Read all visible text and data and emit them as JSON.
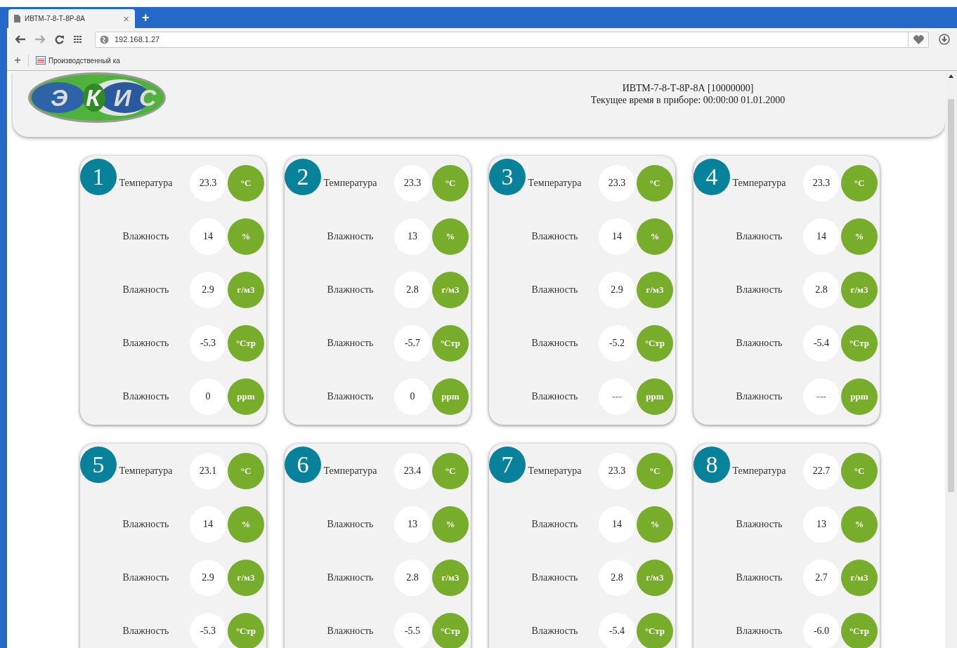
{
  "browser": {
    "tab_title": "ИВТМ-7-8-Т-8Р-8А",
    "tab_close": "×",
    "new_tab": "+",
    "address": "192.168.1.27",
    "bookmark_add": "+",
    "bookmark": "Производственный ка"
  },
  "header": {
    "logo_letters": [
      "Э",
      "К",
      "И",
      "С"
    ],
    "device": "ИВТМ-7-8-Т-8Р-8А [10000000]",
    "time": "Текущее время в приборе: 00:00:00 01.01.2000"
  },
  "channels": [
    {
      "number": "1",
      "rows": [
        {
          "label": "Температура",
          "value": "23.3",
          "kind": "ok",
          "unit": "°C"
        },
        {
          "label": "Влажность",
          "value": "14",
          "kind": "ok",
          "unit": "%"
        },
        {
          "label": "Влажность",
          "value": "2.9",
          "kind": "ok",
          "unit": "г/м3"
        },
        {
          "label": "Влажность",
          "value": "-5.3",
          "kind": "ok",
          "unit": "°Стр"
        },
        {
          "label": "Влажность",
          "value": "0",
          "kind": "ok",
          "unit": "ppm"
        }
      ]
    },
    {
      "number": "2",
      "rows": [
        {
          "label": "Температура",
          "value": "23.3",
          "kind": "ok",
          "unit": "°C"
        },
        {
          "label": "Влажность",
          "value": "13",
          "kind": "ok",
          "unit": "%"
        },
        {
          "label": "Влажность",
          "value": "2.8",
          "kind": "ok",
          "unit": "г/м3"
        },
        {
          "label": "Влажность",
          "value": "-5.7",
          "kind": "ok",
          "unit": "°Стр"
        },
        {
          "label": "Влажность",
          "value": "0",
          "kind": "ok",
          "unit": "ppm"
        }
      ]
    },
    {
      "number": "3",
      "rows": [
        {
          "label": "Температура",
          "value": "23.3",
          "kind": "ok",
          "unit": "°C"
        },
        {
          "label": "Влажность",
          "value": "14",
          "kind": "ok",
          "unit": "%"
        },
        {
          "label": "Влажность",
          "value": "2.9",
          "kind": "ok",
          "unit": "г/м3"
        },
        {
          "label": "Влажность",
          "value": "-5.2",
          "kind": "ok",
          "unit": "°Стр"
        },
        {
          "label": "Влажность",
          "value": "---",
          "kind": "error",
          "unit": "ppm"
        }
      ]
    },
    {
      "number": "4",
      "rows": [
        {
          "label": "Температура",
          "value": "23.3",
          "kind": "ok",
          "unit": "°C"
        },
        {
          "label": "Влажность",
          "value": "14",
          "kind": "ok",
          "unit": "%"
        },
        {
          "label": "Влажность",
          "value": "2.8",
          "kind": "ok",
          "unit": "г/м3"
        },
        {
          "label": "Влажность",
          "value": "-5.4",
          "kind": "ok",
          "unit": "°Стр"
        },
        {
          "label": "Влажность",
          "value": "---",
          "kind": "error",
          "unit": "ppm"
        }
      ]
    },
    {
      "number": "5",
      "rows": [
        {
          "label": "Температура",
          "value": "23.1",
          "kind": "ok",
          "unit": "°C"
        },
        {
          "label": "Влажность",
          "value": "14",
          "kind": "ok",
          "unit": "%"
        },
        {
          "label": "Влажность",
          "value": "2.9",
          "kind": "ok",
          "unit": "г/м3"
        },
        {
          "label": "Влажность",
          "value": "-5.3",
          "kind": "ok",
          "unit": "°Стр"
        }
      ]
    },
    {
      "number": "6",
      "rows": [
        {
          "label": "Температура",
          "value": "23.4",
          "kind": "ok",
          "unit": "°C"
        },
        {
          "label": "Влажность",
          "value": "13",
          "kind": "ok",
          "unit": "%"
        },
        {
          "label": "Влажность",
          "value": "2.8",
          "kind": "ok",
          "unit": "г/м3"
        },
        {
          "label": "Влажность",
          "value": "-5.5",
          "kind": "ok",
          "unit": "°Стр"
        }
      ]
    },
    {
      "number": "7",
      "rows": [
        {
          "label": "Температура",
          "value": "23.3",
          "kind": "ok",
          "unit": "°C"
        },
        {
          "label": "Влажность",
          "value": "14",
          "kind": "ok",
          "unit": "%"
        },
        {
          "label": "Влажность",
          "value": "2.8",
          "kind": "ok",
          "unit": "г/м3"
        },
        {
          "label": "Влажность",
          "value": "-5.4",
          "kind": "ok",
          "unit": "°Стр"
        }
      ]
    },
    {
      "number": "8",
      "rows": [
        {
          "label": "Температура",
          "value": "22.7",
          "kind": "ok",
          "unit": "°C"
        },
        {
          "label": "Влажность",
          "value": "13",
          "kind": "ok",
          "unit": "%"
        },
        {
          "label": "Влажность",
          "value": "2.7",
          "kind": "ok",
          "unit": "г/м3"
        },
        {
          "label": "Влажность",
          "value": "-6.0",
          "kind": "ok",
          "unit": "°Стр"
        }
      ]
    }
  ]
}
